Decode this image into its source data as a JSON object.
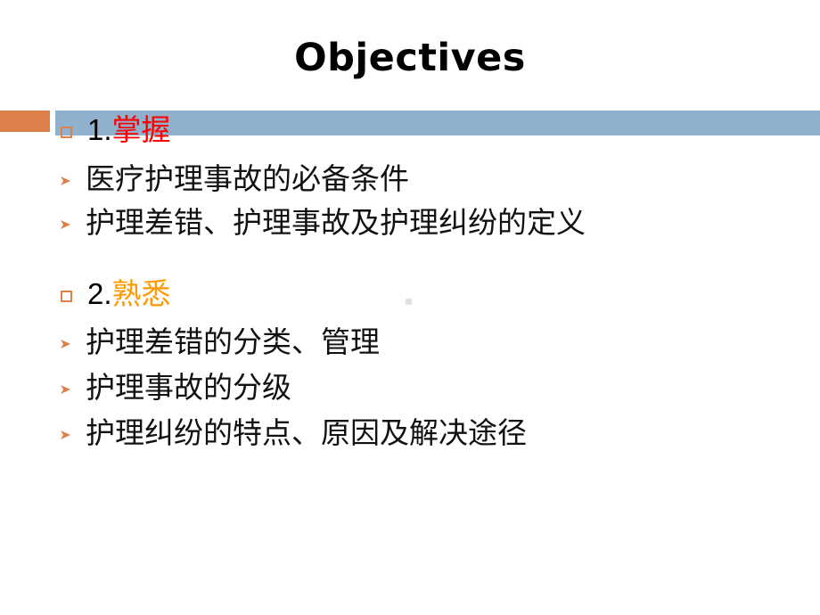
{
  "slide": {
    "title": "Objectives",
    "background_color": "#FFFFFF",
    "decor": {
      "orange_block_color": "#DD8049",
      "blue_bar_color": "#8FB1CD"
    },
    "marker_colors": {
      "square_outline": "#DD8049",
      "arrow": "#DD8049"
    },
    "accent_colors": {
      "red": "#FF0000",
      "orange": "#FF9900"
    }
  },
  "outline": {
    "groups": [
      {
        "number": "1.",
        "keyword": "掌握",
        "keyword_color": "#FF0000",
        "marker": "square-bullet-icon",
        "items": [
          {
            "marker": "arrow-bullet-icon",
            "text": "医疗护理事故的必备条件"
          },
          {
            "marker": "arrow-bullet-icon",
            "text": "护理差错、护理事故及护理纠纷的定义"
          }
        ]
      },
      {
        "number": "2.",
        "keyword": "熟悉",
        "keyword_color": "#FF9900",
        "marker": "square-bullet-icon",
        "items": [
          {
            "marker": "arrow-bullet-icon",
            "text": "护理差错的分类、管理"
          },
          {
            "marker": "arrow-bullet-icon",
            "text": "护理事故的分级"
          },
          {
            "marker": "arrow-bullet-icon",
            "text": "护理纠纷的特点、原因及解决途径"
          }
        ]
      }
    ]
  }
}
